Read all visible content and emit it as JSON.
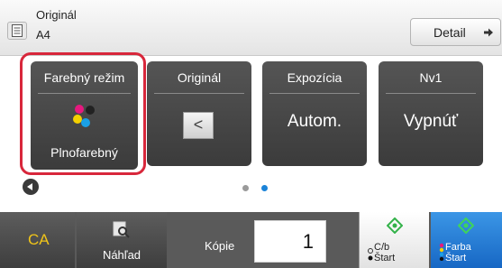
{
  "header": {
    "original_label": "Originál",
    "original_size": "A4",
    "detail_button": "Detail",
    "doc_icon": "document-icon",
    "detail_icon": "arrow-right-icon"
  },
  "tiles": [
    {
      "name": "color-mode",
      "title": "Farebný režim",
      "value": "Plnofarebný",
      "icon": "cmyk-dots-icon",
      "selected": true
    },
    {
      "name": "original",
      "title": "Originál",
      "icon": "orientation-icon",
      "glyph": "<"
    },
    {
      "name": "exposure",
      "title": "Expozícia",
      "value": "Autom."
    },
    {
      "name": "n-up",
      "title": "Nv1",
      "value": "Vypnúť"
    }
  ],
  "navigation": {
    "prev_icon": "chevron-left-icon",
    "pages": 2,
    "current_page": 2
  },
  "bottom": {
    "ca_label": "CA",
    "preview_label": "Náhľad",
    "preview_icon": "preview-magnifier-icon",
    "copies_label": "Kópie",
    "copies_value": "1",
    "bw_start": {
      "line1": "C/b",
      "line2": "Štart",
      "icon": "start-diamond-icon"
    },
    "color_start": {
      "line1": "Farba",
      "line2": "Štart",
      "icon": "start-diamond-icon"
    }
  },
  "colors": {
    "accent_blue": "#1b83d8",
    "highlight_red": "#d8273b",
    "start_green": "#34b24a",
    "ca_yellow": "#f0c419",
    "tile_gray": "#4a4a4a"
  }
}
